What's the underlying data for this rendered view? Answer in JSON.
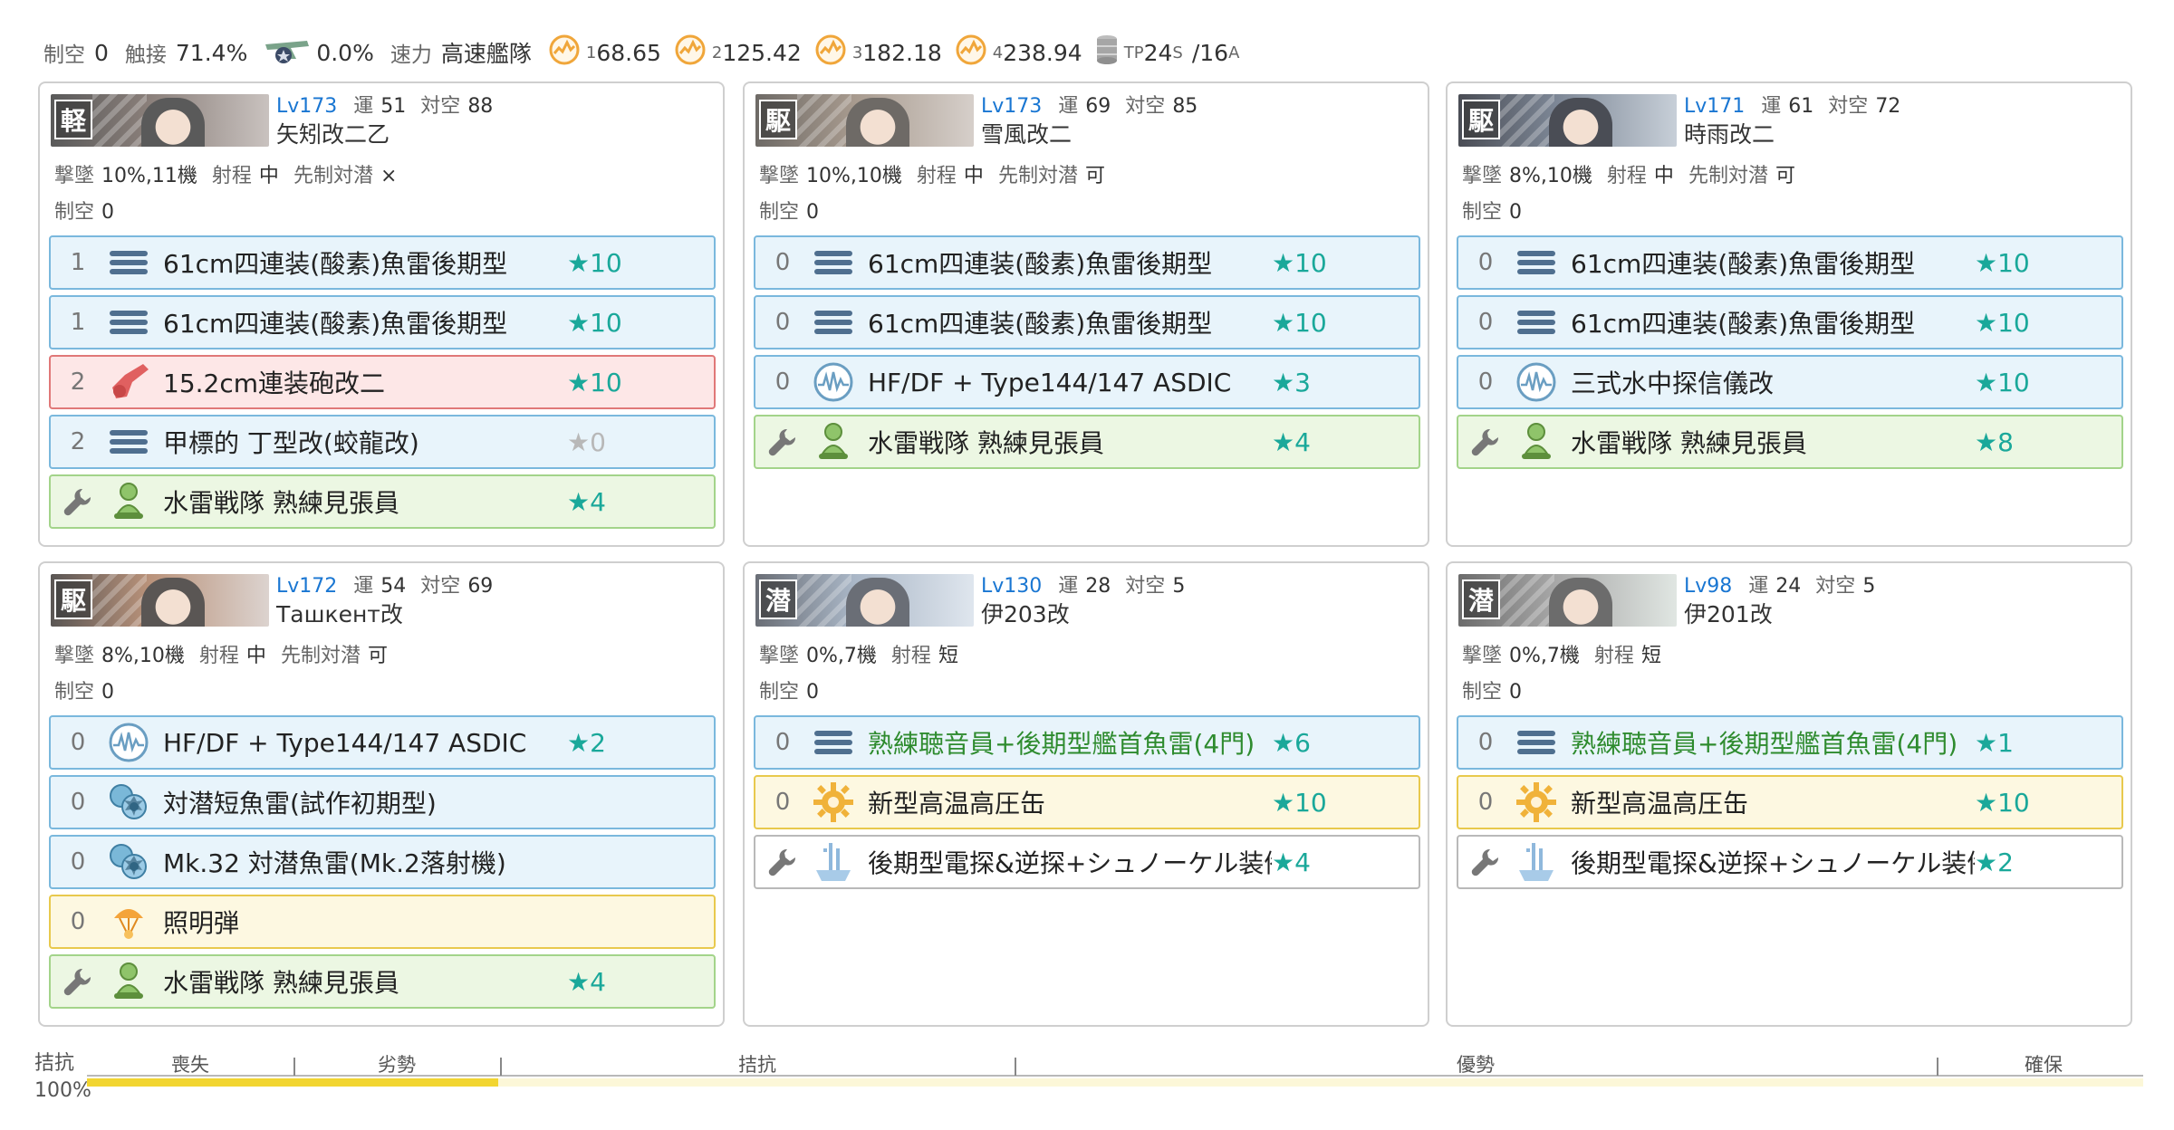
{
  "summary": {
    "air_label": "制空",
    "air_value": "0",
    "contact_label": "触接",
    "contact_value": "71.4%",
    "recon_value": "0.0%",
    "speed_label": "速力",
    "speed_value": "高速艦隊",
    "los": [
      {
        "sub": "1",
        "value": "68.65"
      },
      {
        "sub": "2",
        "value": "125.42"
      },
      {
        "sub": "3",
        "value": "182.18"
      },
      {
        "sub": "4",
        "value": "238.94"
      }
    ],
    "tp_label": "TP",
    "tp_s": "24",
    "tp_s_sub": "S",
    "tp_sep": "/ ",
    "tp_a": "16",
    "tp_a_sub": "A"
  },
  "labels": {
    "lv": "Lv",
    "luck": "運",
    "aa": "対空",
    "shootdown": "撃墜",
    "range": "射程",
    "oasw": "先制対潜",
    "air": "制空"
  },
  "ships": [
    {
      "type_tag": "軽",
      "lv": "173",
      "luck": "51",
      "aa": "88",
      "name": "矢矧改二乙",
      "shootdown": "10%,11機",
      "range": "中",
      "oasw": "×",
      "air": "0",
      "colors": [
        "#5a5a5a",
        "#8a7f7a",
        "#c9c2bf"
      ],
      "equips": [
        {
          "slot": "1",
          "icon": "torpedo-icon",
          "name": "61cm四連装(酸素)魚雷後期型",
          "star": "★10",
          "tone": "blue"
        },
        {
          "slot": "1",
          "icon": "torpedo-icon",
          "name": "61cm四連装(酸素)魚雷後期型",
          "star": "★10",
          "tone": "blue"
        },
        {
          "slot": "2",
          "icon": "medium-gun-icon",
          "name": "15.2cm連装砲改二",
          "star": "★10",
          "tone": "red"
        },
        {
          "slot": "2",
          "icon": "torpedo-icon",
          "name": "甲標的 丁型改(蛟龍改)",
          "star": "★0",
          "tone": "blue",
          "grey": true
        },
        {
          "slot": "",
          "icon": "lookout-icon",
          "name": "水雷戦隊 熟練見張員",
          "star": "★4",
          "tone": "green",
          "ex": true
        }
      ]
    },
    {
      "type_tag": "駆",
      "lv": "173",
      "luck": "69",
      "aa": "85",
      "name": "雪風改二",
      "shootdown": "10%,10機",
      "range": "中",
      "oasw": "可",
      "air": "0",
      "colors": [
        "#6e6a66",
        "#a79a8e",
        "#d6cfca"
      ],
      "equips": [
        {
          "slot": "0",
          "icon": "torpedo-icon",
          "name": "61cm四連装(酸素)魚雷後期型",
          "star": "★10",
          "tone": "blue"
        },
        {
          "slot": "0",
          "icon": "torpedo-icon",
          "name": "61cm四連装(酸素)魚雷後期型",
          "star": "★10",
          "tone": "blue"
        },
        {
          "slot": "0",
          "icon": "sonar-icon",
          "name": "HF/DF + Type144/147 ASDIC",
          "star": "★3",
          "tone": "blue"
        },
        {
          "slot": "",
          "icon": "lookout-icon",
          "name": "水雷戦隊 熟練見張員",
          "star": "★4",
          "tone": "green",
          "ex": true
        }
      ]
    },
    {
      "type_tag": "駆",
      "lv": "171",
      "luck": "61",
      "aa": "72",
      "name": "時雨改二",
      "shootdown": "8%,10機",
      "range": "中",
      "oasw": "可",
      "air": "0",
      "colors": [
        "#4a4d55",
        "#7d8796",
        "#c7cfd8"
      ],
      "equips": [
        {
          "slot": "0",
          "icon": "torpedo-icon",
          "name": "61cm四連装(酸素)魚雷後期型",
          "star": "★10",
          "tone": "blue"
        },
        {
          "slot": "0",
          "icon": "torpedo-icon",
          "name": "61cm四連装(酸素)魚雷後期型",
          "star": "★10",
          "tone": "blue"
        },
        {
          "slot": "0",
          "icon": "sonar-icon",
          "name": "三式水中探信儀改",
          "star": "★10",
          "tone": "blue"
        },
        {
          "slot": "",
          "icon": "lookout-icon",
          "name": "水雷戦隊 熟練見張員",
          "star": "★8",
          "tone": "green",
          "ex": true
        }
      ]
    },
    {
      "type_tag": "駆",
      "lv": "172",
      "luck": "54",
      "aa": "69",
      "name": "Ташкент改",
      "shootdown": "8%,10機",
      "range": "中",
      "oasw": "可",
      "air": "0",
      "colors": [
        "#5a5654",
        "#b9927a",
        "#dcd3cf"
      ],
      "equips": [
        {
          "slot": "0",
          "icon": "sonar-icon",
          "name": "HF/DF + Type144/147 ASDIC",
          "star": "★2",
          "tone": "blue"
        },
        {
          "slot": "0",
          "icon": "depth-charge-icon",
          "name": "対潜短魚雷(試作初期型)",
          "star": "",
          "tone": "blue"
        },
        {
          "slot": "0",
          "icon": "depth-charge-icon",
          "name": "Mk.32 対潜魚雷(Mk.2落射機)",
          "star": "",
          "tone": "blue"
        },
        {
          "slot": "0",
          "icon": "flare-icon",
          "name": "照明弾",
          "star": "",
          "tone": "yellow"
        },
        {
          "slot": "",
          "icon": "lookout-icon",
          "name": "水雷戦隊 熟練見張員",
          "star": "★4",
          "tone": "green",
          "ex": true
        }
      ]
    },
    {
      "type_tag": "潜",
      "lv": "130",
      "luck": "28",
      "aa": "5",
      "name": "伊203改",
      "shootdown": "0%,7機",
      "range": "短",
      "oasw": "",
      "air": "0",
      "colors": [
        "#6a6e76",
        "#a9b6c6",
        "#dfe6ee"
      ],
      "equips": [
        {
          "slot": "0",
          "icon": "torpedo-icon",
          "name": "熟練聴音員+後期型艦首魚雷(4門)",
          "star": "★6",
          "tone": "blue",
          "green_name": true
        },
        {
          "slot": "0",
          "icon": "boiler-icon",
          "name": "新型高温高圧缶",
          "star": "★10",
          "tone": "yellow"
        },
        {
          "slot": "",
          "icon": "radar-icon",
          "name": "後期型電探&逆探+シュノーケル装備",
          "star": "★4",
          "tone": "white",
          "ex": true
        }
      ]
    },
    {
      "type_tag": "潜",
      "lv": "98",
      "luck": "24",
      "aa": "5",
      "name": "伊201改",
      "shootdown": "0%,7機",
      "range": "短",
      "oasw": "",
      "air": "0",
      "colors": [
        "#6c6c6c",
        "#a8a8a8",
        "#e0e6e2"
      ],
      "equips": [
        {
          "slot": "0",
          "icon": "torpedo-icon",
          "name": "熟練聴音員+後期型艦首魚雷(4門)",
          "star": "★1",
          "tone": "blue",
          "green_name": true
        },
        {
          "slot": "0",
          "icon": "boiler-icon",
          "name": "新型高温高圧缶",
          "star": "★10",
          "tone": "yellow"
        },
        {
          "slot": "",
          "icon": "radar-icon",
          "name": "後期型電探&逆探+シュノーケル装備",
          "star": "★2",
          "tone": "white",
          "ex": true
        }
      ]
    }
  ],
  "gauge": {
    "status": "拮抗",
    "percent": "100%",
    "fill_fraction": 0.2,
    "labels": [
      "喪失",
      "劣勢",
      "拮抗",
      "優勢",
      "確保"
    ]
  }
}
